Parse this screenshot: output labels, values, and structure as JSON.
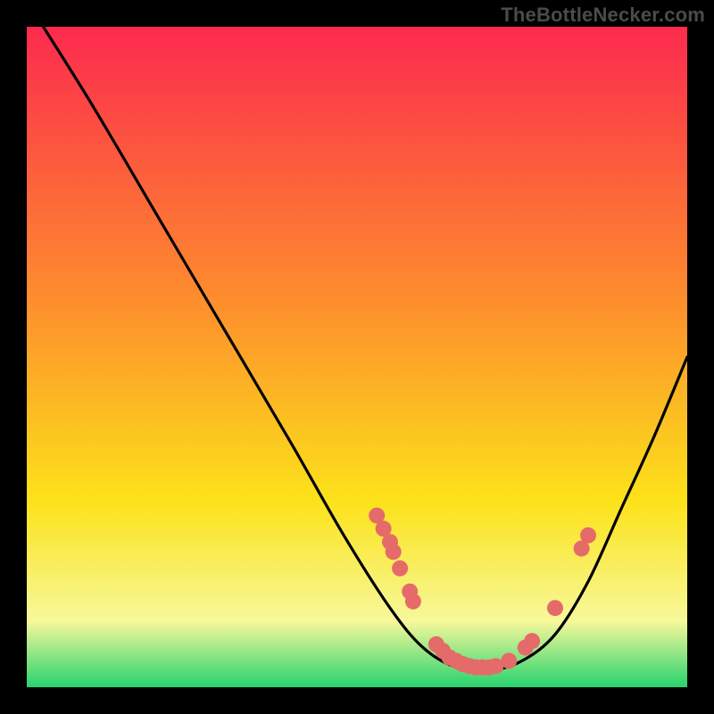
{
  "watermark": "TheBottleNecker.com",
  "chart_data": {
    "type": "line",
    "title": "",
    "xlabel": "",
    "ylabel": "",
    "xlim": [
      0,
      100
    ],
    "ylim": [
      0,
      100
    ],
    "gradient_background": {
      "top": "#fc2a4e",
      "mid": "#fce21a",
      "bottom": "#27d36e"
    },
    "curve": [
      {
        "x": 2.5,
        "y": 100
      },
      {
        "x": 10,
        "y": 88
      },
      {
        "x": 20,
        "y": 71
      },
      {
        "x": 30,
        "y": 54
      },
      {
        "x": 40,
        "y": 37
      },
      {
        "x": 48,
        "y": 23
      },
      {
        "x": 55,
        "y": 12
      },
      {
        "x": 60,
        "y": 6
      },
      {
        "x": 65,
        "y": 3
      },
      {
        "x": 70,
        "y": 2.5
      },
      {
        "x": 75,
        "y": 4
      },
      {
        "x": 80,
        "y": 8
      },
      {
        "x": 85,
        "y": 16
      },
      {
        "x": 90,
        "y": 27
      },
      {
        "x": 95,
        "y": 38
      },
      {
        "x": 100,
        "y": 50
      }
    ],
    "markers": [
      {
        "x": 53,
        "y": 26
      },
      {
        "x": 54,
        "y": 24
      },
      {
        "x": 55,
        "y": 22
      },
      {
        "x": 55.5,
        "y": 20.5
      },
      {
        "x": 56.5,
        "y": 18
      },
      {
        "x": 58,
        "y": 14.5
      },
      {
        "x": 58.5,
        "y": 13
      },
      {
        "x": 62,
        "y": 6.5
      },
      {
        "x": 63,
        "y": 5.5
      },
      {
        "x": 64,
        "y": 4.5
      },
      {
        "x": 65,
        "y": 4
      },
      {
        "x": 66,
        "y": 3.5
      },
      {
        "x": 67,
        "y": 3.2
      },
      {
        "x": 68,
        "y": 3
      },
      {
        "x": 69,
        "y": 3
      },
      {
        "x": 70,
        "y": 3
      },
      {
        "x": 71,
        "y": 3.2
      },
      {
        "x": 73,
        "y": 4
      },
      {
        "x": 75.5,
        "y": 6
      },
      {
        "x": 76.5,
        "y": 7
      },
      {
        "x": 80,
        "y": 12
      },
      {
        "x": 84,
        "y": 21
      },
      {
        "x": 85,
        "y": 23
      }
    ],
    "marker_color": "#e56a6a",
    "marker_radius_px": 9,
    "line_color": "#000000"
  }
}
